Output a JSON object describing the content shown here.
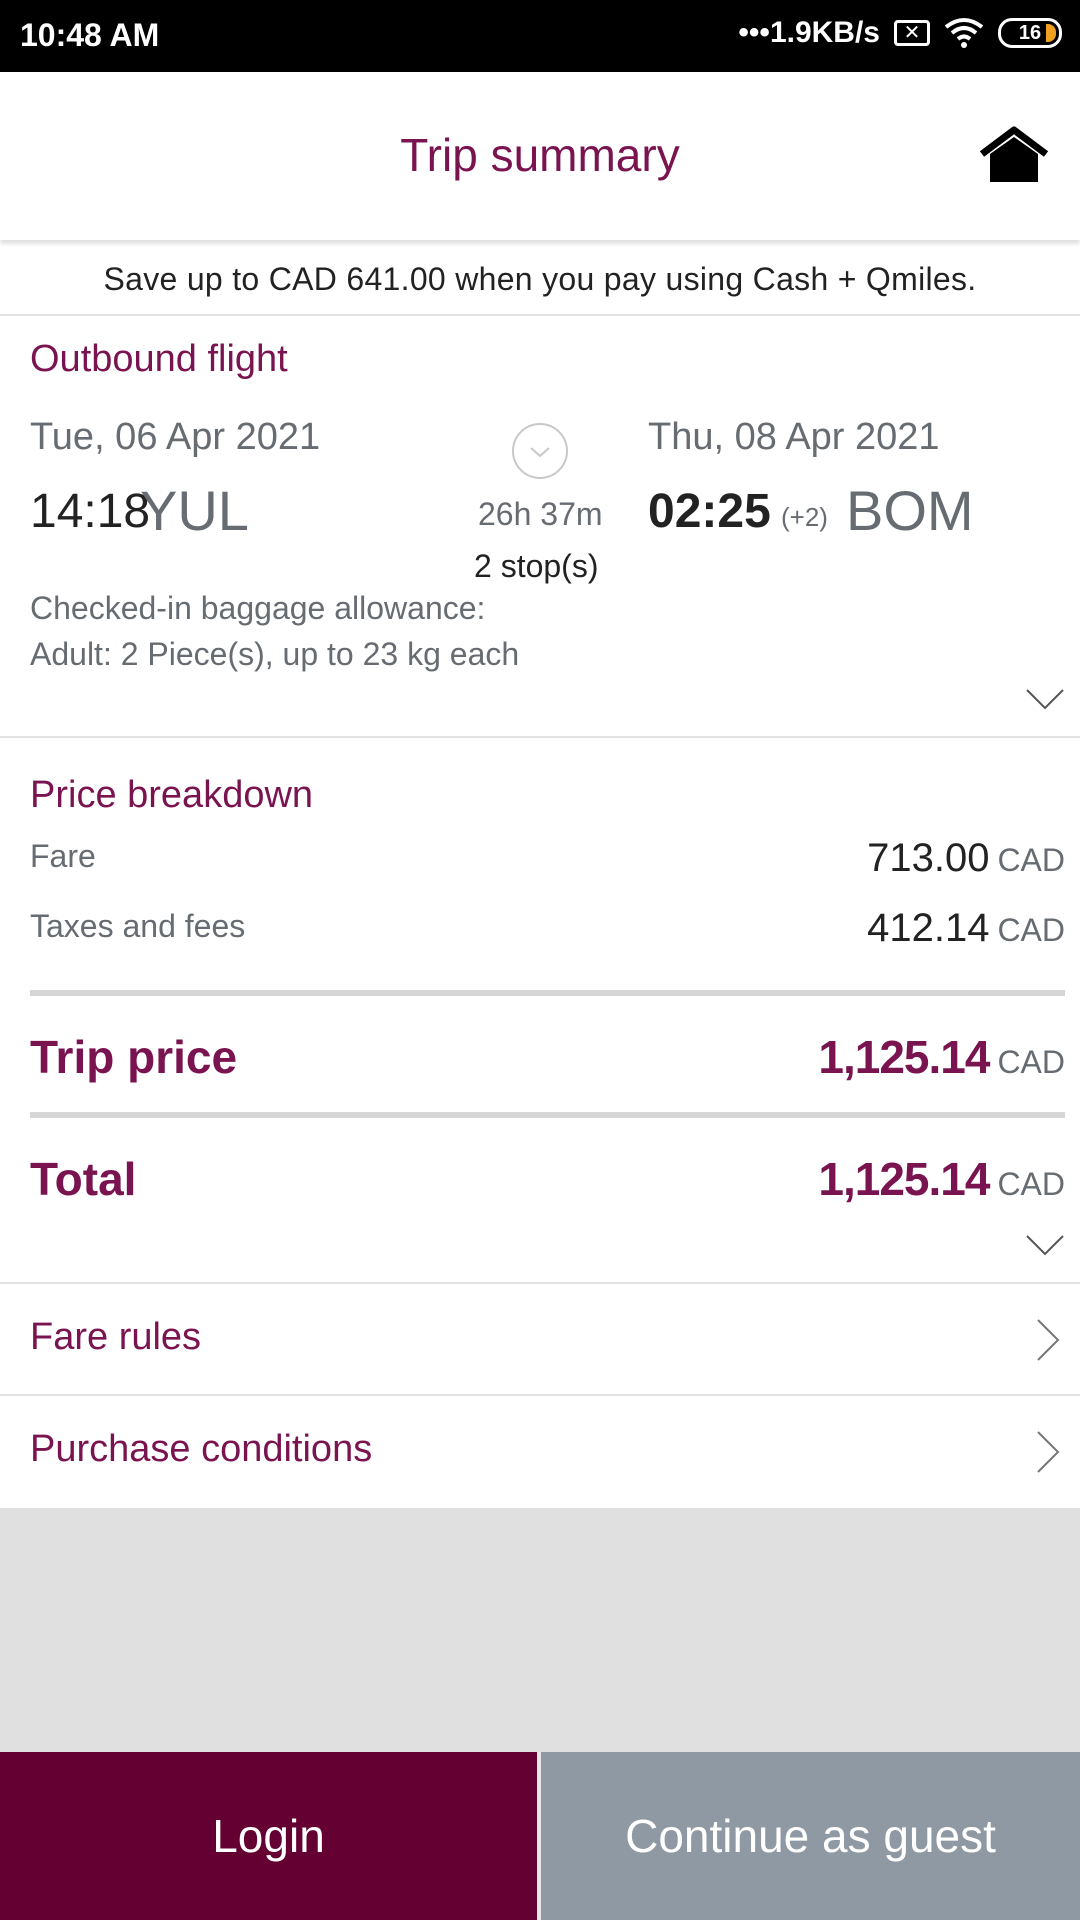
{
  "status_bar": {
    "time": "10:48 AM",
    "network_speed": "1.9KB/s",
    "battery": "16",
    "icons": [
      "signal-dots-icon",
      "sim-x-icon",
      "wifi-icon",
      "battery-icon"
    ]
  },
  "header": {
    "title": "Trip summary",
    "home_icon": "home-icon"
  },
  "promo": {
    "text": "Save up to CAD 641.00 when you pay using Cash + Qmiles."
  },
  "outbound": {
    "section_title": "Outbound flight",
    "depart_date": "Tue, 06 Apr 2021",
    "depart_time": "14:18",
    "depart_airport": "YUL",
    "arrive_date": "Thu, 08 Apr 2021",
    "arrive_time": "02:25",
    "day_offset": "(+2)",
    "arrive_airport": "BOM",
    "duration": "26h 37m",
    "stops": "2 stop(s)",
    "baggage_label": "Checked-in baggage allowance:",
    "baggage_detail": "Adult: 2 Piece(s), up to 23 kg each"
  },
  "price": {
    "section_title": "Price breakdown",
    "currency": "CAD",
    "fare_label": "Fare",
    "fare_value": "713.00",
    "taxes_label": "Taxes and fees",
    "taxes_value": "412.14",
    "trip_price_label": "Trip price",
    "trip_price_value": "1,125.14",
    "total_label": "Total",
    "total_value": "1,125.14"
  },
  "links": {
    "fare_rules": "Fare rules",
    "purchase_conditions": "Purchase conditions"
  },
  "buttons": {
    "login": "Login",
    "guest": "Continue as guest"
  },
  "colors": {
    "brand": "#7a1450",
    "login_bg": "#640032",
    "guest_bg": "#8f99a3"
  }
}
